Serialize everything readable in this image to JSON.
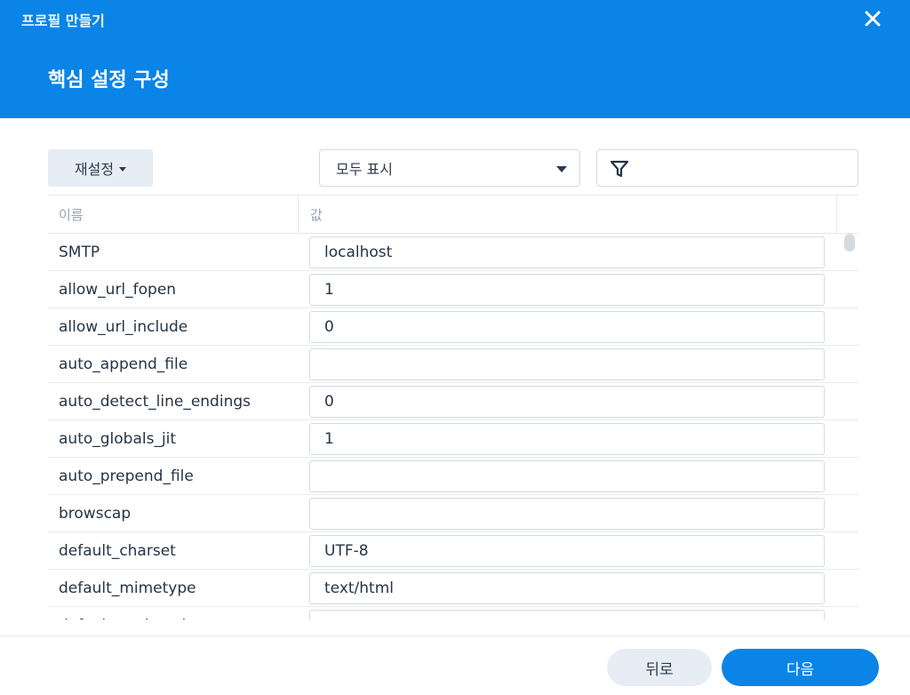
{
  "window": {
    "title": "프로필 만들기",
    "close_icon": "close-icon"
  },
  "step": {
    "title": "핵심 설정 구성"
  },
  "toolbar": {
    "reset_label": "재설정",
    "show_select_value": "모두 표시",
    "filter_icon": "filter-icon",
    "filter_value": ""
  },
  "table": {
    "columns": [
      "이름",
      "값"
    ],
    "rows": [
      {
        "name": "SMTP",
        "value": "localhost"
      },
      {
        "name": "allow_url_fopen",
        "value": "1"
      },
      {
        "name": "allow_url_include",
        "value": "0"
      },
      {
        "name": "auto_append_file",
        "value": ""
      },
      {
        "name": "auto_detect_line_endings",
        "value": "0"
      },
      {
        "name": "auto_globals_jit",
        "value": "1"
      },
      {
        "name": "auto_prepend_file",
        "value": ""
      },
      {
        "name": "browscap",
        "value": ""
      },
      {
        "name": "default_charset",
        "value": "UTF-8"
      },
      {
        "name": "default_mimetype",
        "value": "text/html"
      },
      {
        "name": "default_socket_timeout",
        "value": ""
      }
    ]
  },
  "footer": {
    "back_label": "뒤로",
    "next_label": "다음"
  },
  "colors": {
    "accent": "#0a84e6",
    "secondary_button": "#e6edf4",
    "text": "#253447"
  }
}
